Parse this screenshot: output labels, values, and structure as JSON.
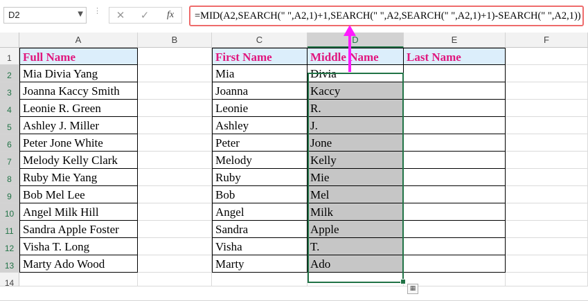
{
  "formula_bar": {
    "name_box": "D2",
    "formula": "=MID(A2,SEARCH(\" \",A2,1)+1,SEARCH(\" \",A2,SEARCH(\" \",A2,1)+1)-SEARCH(\" \",A2,1))",
    "cancel_glyph": "✕",
    "enter_glyph": "✓",
    "fx_label": "fx",
    "accent_color": "#ff1aff",
    "highlight_color": "#ee6b6b"
  },
  "columns": [
    "A",
    "B",
    "C",
    "D",
    "E",
    "F"
  ],
  "rows": [
    "1",
    "2",
    "3",
    "4",
    "5",
    "6",
    "7",
    "8",
    "9",
    "10",
    "11",
    "12",
    "13",
    "14"
  ],
  "headers": {
    "full_name": "Full Name",
    "first_name": "First Name",
    "middle_name": "Middle Name",
    "last_name": "Last Name"
  },
  "full_names": [
    "Mia Divia Yang",
    "Joanna Kaccy Smith",
    "Leonie R. Green",
    "Ashley J. Miller",
    "Peter Jone White",
    "Melody Kelly Clark",
    "Ruby Mie Yang",
    "Bob Mel Lee",
    "Angel Milk Hill",
    "Sandra Apple Foster",
    "Visha T. Long",
    "Marty Ado Wood"
  ],
  "first_names": [
    "Mia",
    "Joanna",
    "Leonie",
    "Ashley",
    "Peter",
    "Melody",
    "Ruby",
    "Bob",
    "Angel",
    "Sandra",
    "Visha",
    "Marty"
  ],
  "middle_names": [
    "Divia",
    "Kaccy",
    "R.",
    "J.",
    "Jone",
    "Kelly",
    "Mie",
    "Mel",
    "Milk",
    "Apple",
    "T.",
    "Ado"
  ],
  "header_color": "#e0177e",
  "header_fill": "#dceefb",
  "selection_color": "#217346"
}
